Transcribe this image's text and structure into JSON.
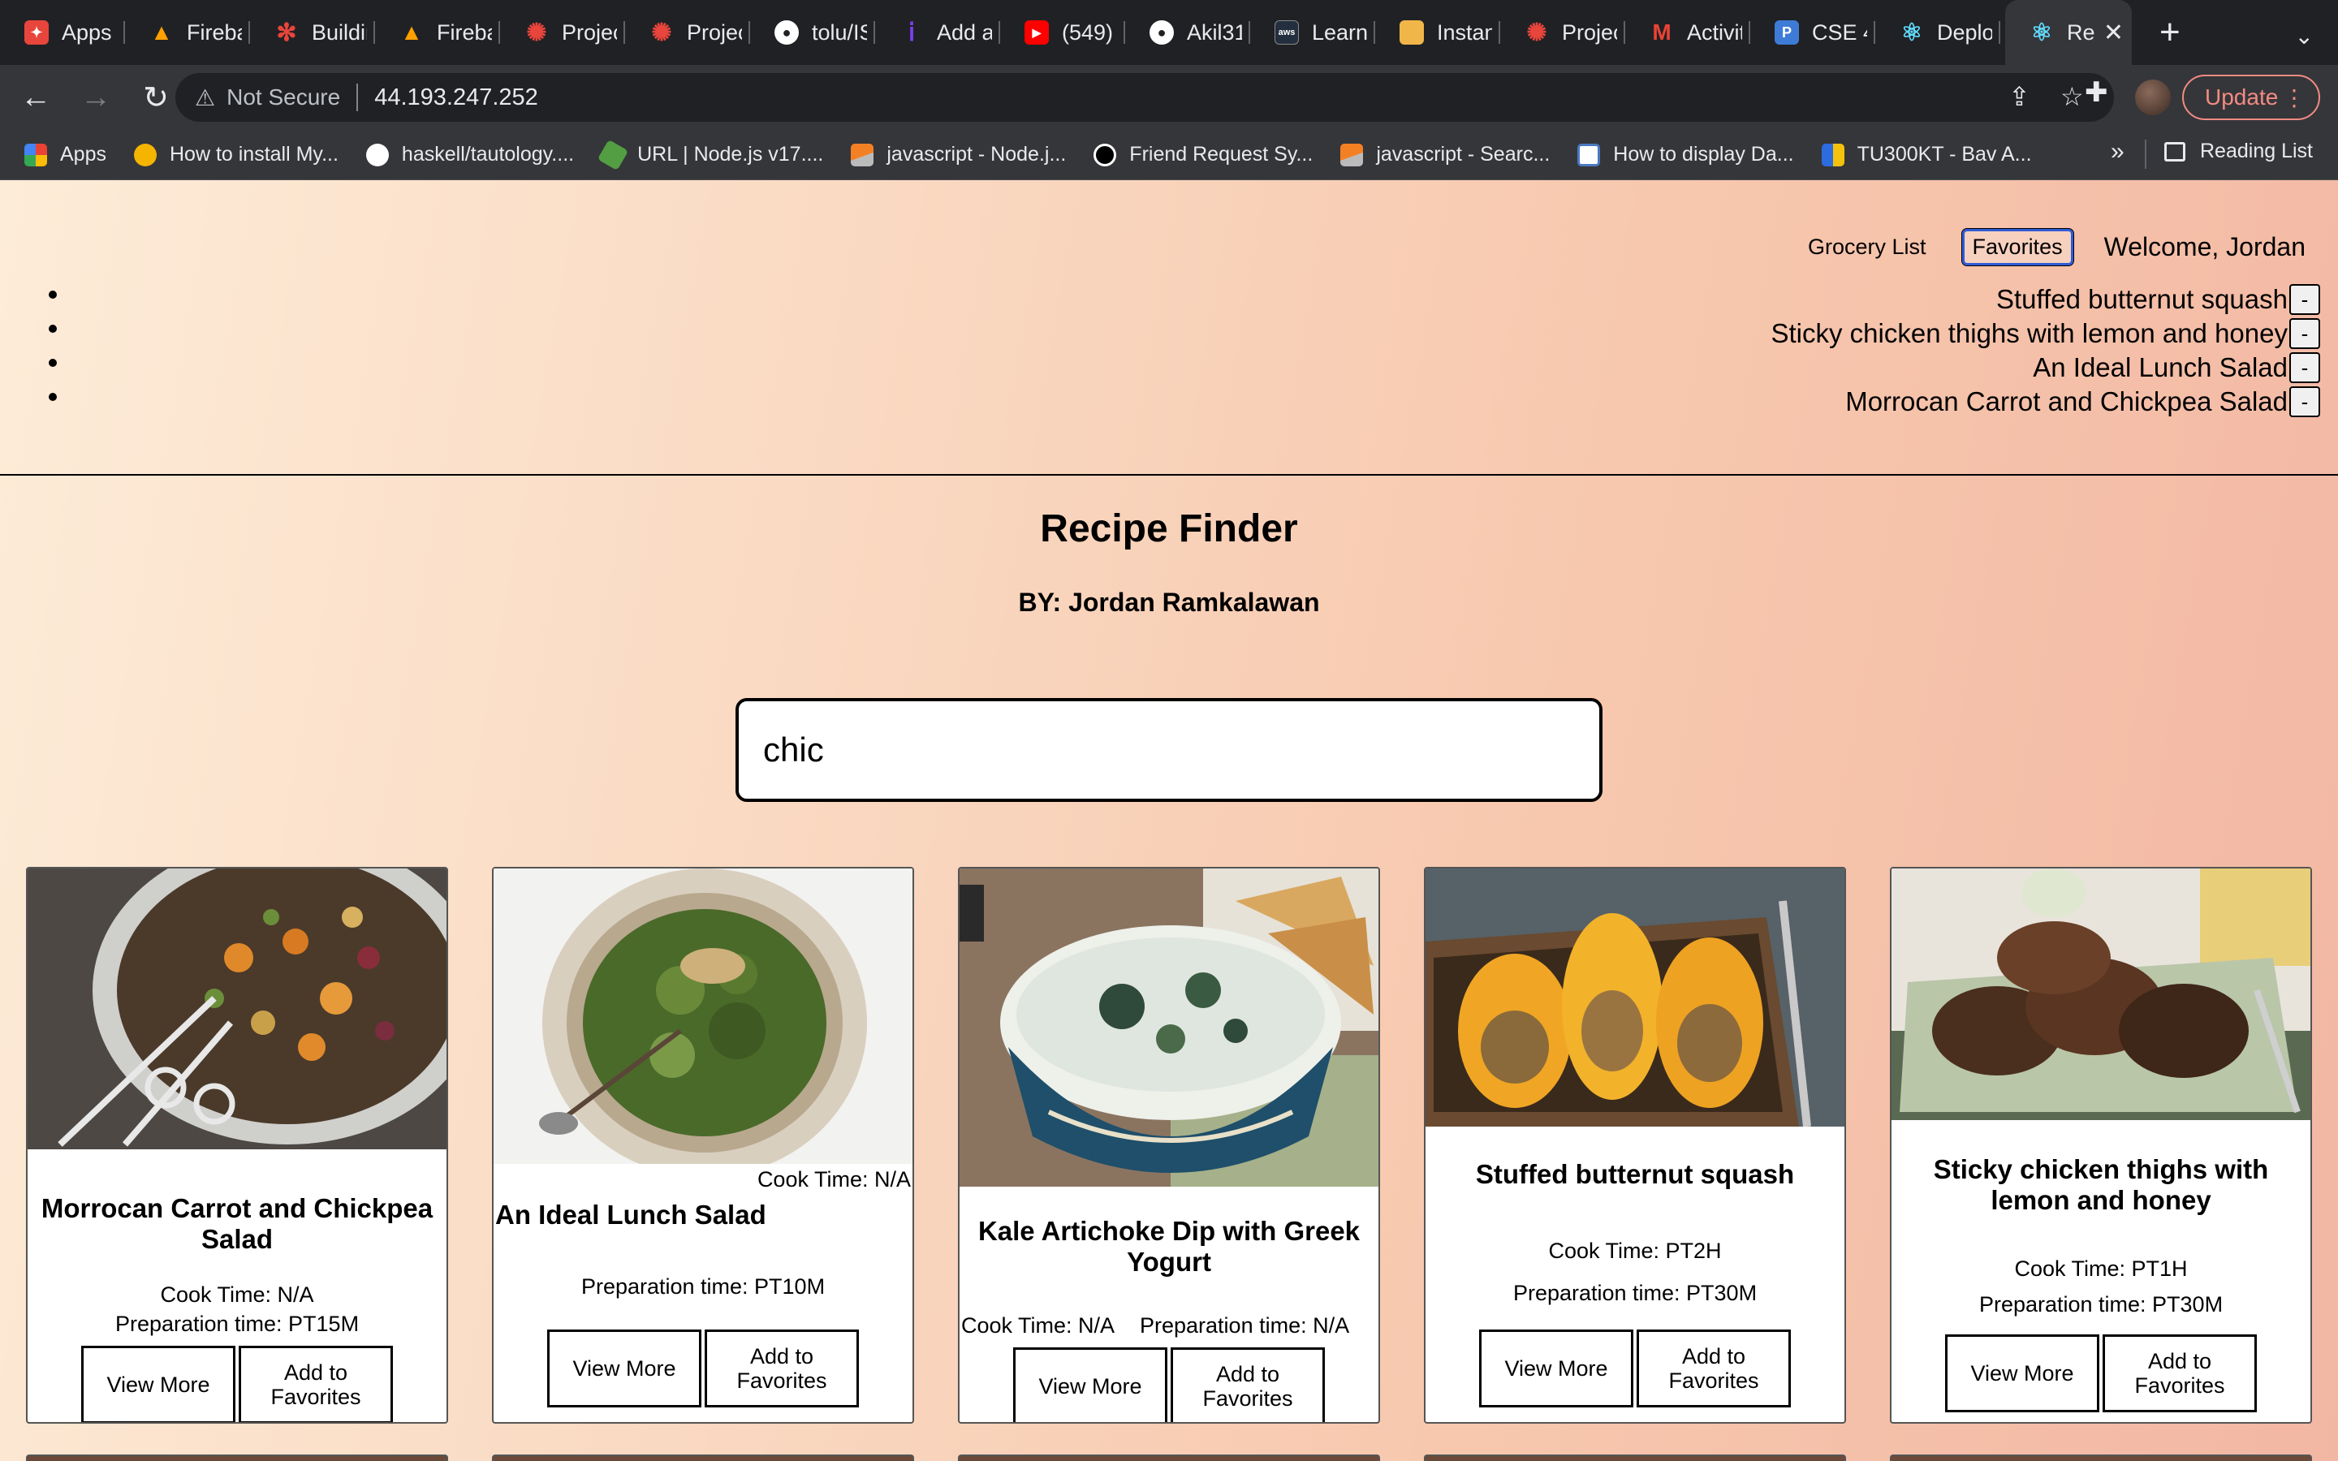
{
  "browser": {
    "tabs": [
      {
        "title": "Apps",
        "icon": "apps-icon",
        "color": "#f4b400"
      },
      {
        "title": "Fireba",
        "icon": "firebase-icon",
        "color": "#ffa000"
      },
      {
        "title": "Buildin",
        "icon": "asterisk-icon",
        "color": "#e8453c"
      },
      {
        "title": "Fireba",
        "icon": "firebase-icon",
        "color": "#ffa000"
      },
      {
        "title": "Projec",
        "icon": "project-icon",
        "color": "#e8453c"
      },
      {
        "title": "Projec",
        "icon": "project-icon",
        "color": "#e8453c"
      },
      {
        "title": "tolu/IS",
        "icon": "github-icon",
        "color": "#ffffff"
      },
      {
        "title": "Add ar",
        "icon": "info-icon",
        "color": "#7b3ff2"
      },
      {
        "title": "(549)",
        "icon": "youtube-icon",
        "color": "#ff0000"
      },
      {
        "title": "Akil31",
        "icon": "github-icon",
        "color": "#ffffff"
      },
      {
        "title": "Learne",
        "icon": "aws-icon",
        "color": "#232f3e"
      },
      {
        "title": "Instanc",
        "icon": "box-icon",
        "color": "#f0b64a"
      },
      {
        "title": "Projec",
        "icon": "project-icon",
        "color": "#e8453c"
      },
      {
        "title": "Activit",
        "icon": "gmail-icon",
        "color": "#ea4335"
      },
      {
        "title": "CSE 4",
        "icon": "piazza-icon",
        "color": "#3e7bd6"
      },
      {
        "title": "Deploy",
        "icon": "react-icon",
        "color": "#61dafb"
      }
    ],
    "active_tab": {
      "title": "Rea",
      "icon": "react-icon",
      "color": "#61dafb"
    },
    "security_label": "Not Secure",
    "url": "44.193.247.252",
    "update_label": "Update",
    "bookmarks": [
      {
        "label": "Apps",
        "icon": "apps-grid-icon",
        "color": "#4285f4"
      },
      {
        "label": "How to install My...",
        "icon": "bookmark-site-icon",
        "color": "#f4b400"
      },
      {
        "label": "haskell/tautology....",
        "icon": "github-icon",
        "color": "#ffffff"
      },
      {
        "label": "URL | Node.js v17....",
        "icon": "nodejs-icon",
        "color": "#539e43"
      },
      {
        "label": "javascript - Node.j...",
        "icon": "stackoverflow-icon",
        "color": "#f48024"
      },
      {
        "label": "Friend Request Sy...",
        "icon": "medium-icon",
        "color": "#ffffff"
      },
      {
        "label": "javascript - Searc...",
        "icon": "stackoverflow-icon",
        "color": "#f48024"
      },
      {
        "label": "How to display Da...",
        "icon": "doc-site-icon",
        "color": "#4a78c2"
      },
      {
        "label": "TU300KT - Bav A...",
        "icon": "flag-icon",
        "color": "#2d6cdf"
      }
    ],
    "reading_list_label": "Reading List"
  },
  "nav": {
    "grocery_label": "Grocery List",
    "favorites_label": "Favorites",
    "welcome": "Welcome, Jordan"
  },
  "favorites": [
    "Stuffed butternut squash",
    "Sticky chicken thighs with lemon and honey",
    "An Ideal Lunch Salad",
    "Morrocan Carrot and Chickpea Salad"
  ],
  "remove_label": "-",
  "title": "Recipe Finder",
  "byline": "BY: Jordan Ramkalawan",
  "search": {
    "value": "chic"
  },
  "buttons": {
    "view_more": "View More",
    "add_fav": "Add to Favorites"
  },
  "cards": [
    {
      "name": "Morrocan Carrot and Chickpea Salad",
      "cook": "Cook Time: N/A",
      "prep": "Preparation time: PT15M",
      "image": "chickpea-salad-photo"
    },
    {
      "name": "An Ideal Lunch Salad",
      "cook": "Cook Time: N/A",
      "prep": "Preparation time: PT10M",
      "image": "lunch-salad-photo"
    },
    {
      "name": "Kale Artichoke Dip with Greek Yogurt",
      "cook": "Cook Time: N/A",
      "prep": "Preparation time: N/A",
      "image": "kale-dip-photo"
    },
    {
      "name": "Stuffed butternut squash",
      "cook": "Cook Time: PT2H",
      "prep": "Preparation time: PT30M",
      "image": "butternut-squash-photo"
    },
    {
      "name": "Sticky chicken thighs with lemon and honey",
      "cook": "Cook Time: PT1H",
      "prep": "Preparation time: PT30M",
      "image": "chicken-thighs-photo"
    }
  ]
}
